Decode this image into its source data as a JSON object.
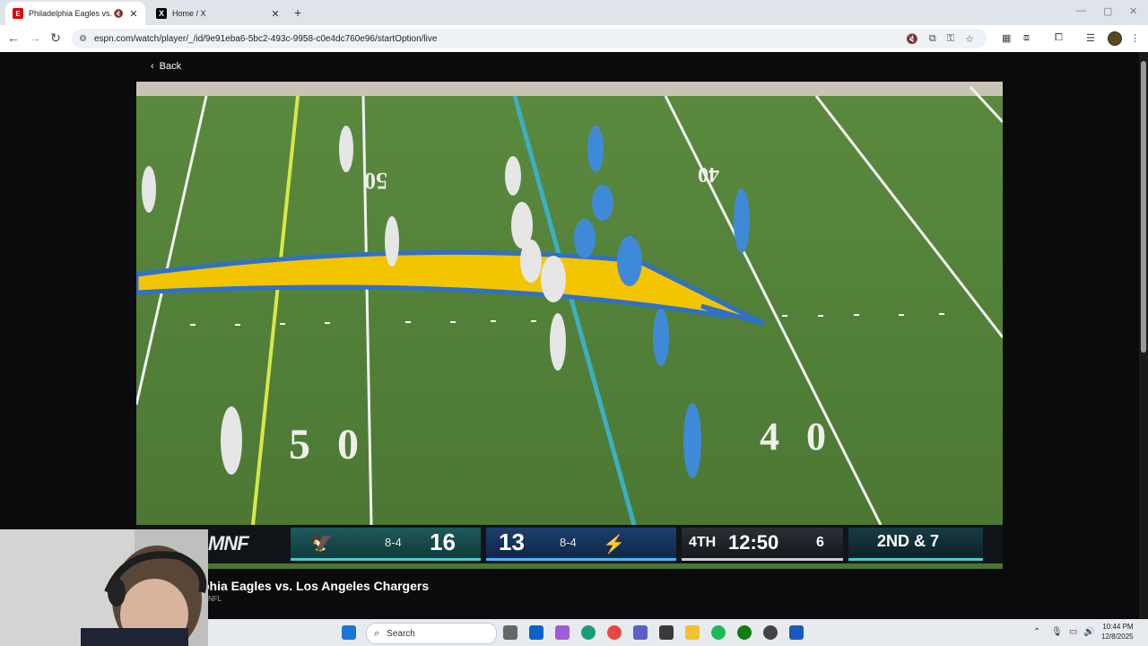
{
  "browser": {
    "tabs": [
      {
        "title": "Philadelphia Eagles vs. Los",
        "active": true,
        "icon": "espn-icon"
      },
      {
        "title": "Home / X",
        "active": false,
        "icon": "x-icon"
      }
    ],
    "url": "espn.com/watch/player/_/id/9e91eba6-5bc2-493c-9958-c0e4dc760e96/startOption/live"
  },
  "page": {
    "back_label": "Back",
    "game_title": "phia Eagles vs. Los Angeles Chargers",
    "game_subtitle": "NFL"
  },
  "scorebug": {
    "network": "MNF",
    "away_record": "8-4",
    "away_score": "16",
    "home_score": "13",
    "home_record": "8-4",
    "quarter": "4TH",
    "clock": "12:50",
    "timeouts": "6",
    "down_distance": "2ND & 7"
  },
  "field_numbers": {
    "top_left": "50",
    "top_right": "40",
    "bottom_left": "50",
    "bottom_right": "40"
  },
  "taskbar": {
    "search_placeholder": "Search",
    "time": "10:44 PM",
    "date": "12/8/2025"
  },
  "colors": {
    "eagles": "#1f5a5a",
    "chargers": "#1d3e6e",
    "field": "#4a7a34"
  }
}
